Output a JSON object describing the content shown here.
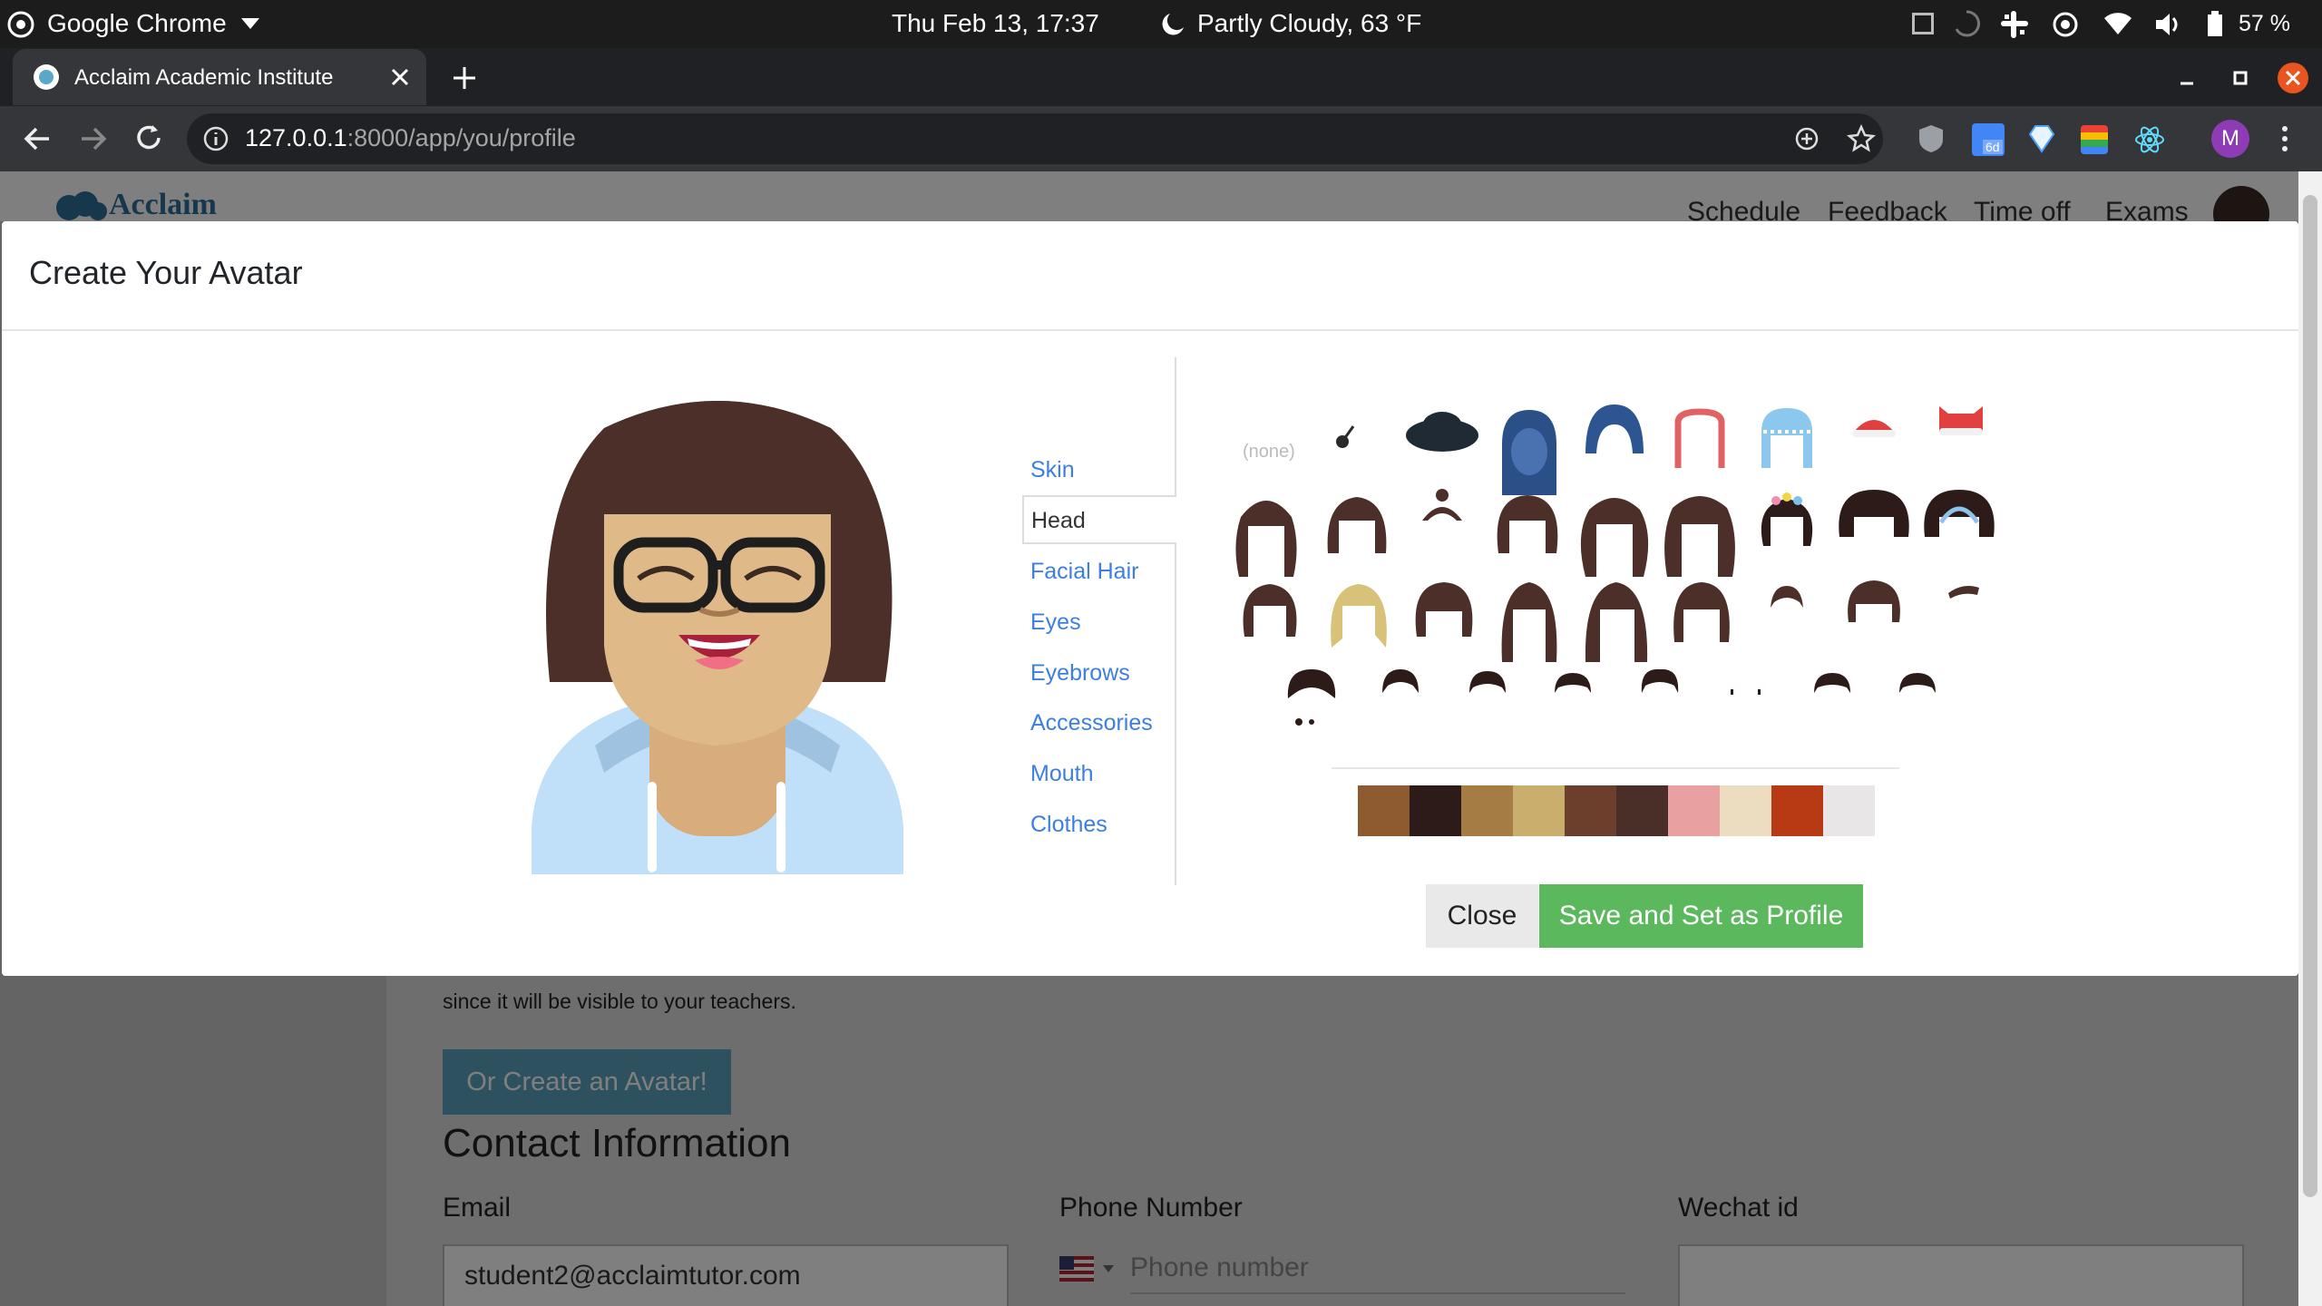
{
  "os": {
    "app_name": "Google Chrome",
    "clock": "Thu Feb 13, 17:37",
    "weather": "Partly Cloudy, 63 °F",
    "battery": "57 %"
  },
  "browser": {
    "tab_title": "Acclaim Academic Institute",
    "url_host": "127.0.0.1",
    "url_path": ":8000/app/you/profile",
    "profile_initial": "M",
    "extension_badge": "6d"
  },
  "site": {
    "logo_text": "Acclaim",
    "nav": [
      "Schedule",
      "Feedback",
      "Time off",
      "Exams"
    ]
  },
  "background_page": {
    "note_text": "since it will be visible to your teachers.",
    "create_avatar_button": "Or Create an Avatar!",
    "contact_heading": "Contact Information",
    "email_label": "Email",
    "email_value": "student2@acclaimtutor.com",
    "phone_label": "Phone Number",
    "phone_placeholder": "Phone number",
    "wechat_label": "Wechat id"
  },
  "modal": {
    "title": "Create Your Avatar",
    "categories": [
      "Skin",
      "Head",
      "Facial Hair",
      "Eyes",
      "Eyebrows",
      "Accessories",
      "Mouth",
      "Clothes"
    ],
    "active_category": "Head",
    "none_option": "(none)",
    "hair_palette": [
      "#8e5a2f",
      "#2c1b18",
      "#a67c45",
      "#c9ae6d",
      "#6b3f2b",
      "#4a2f28",
      "#e8a0a0",
      "#ecdcc0",
      "#b73a14",
      "#e8e6e6"
    ],
    "close_label": "Close",
    "save_label": "Save and Set as Profile"
  }
}
